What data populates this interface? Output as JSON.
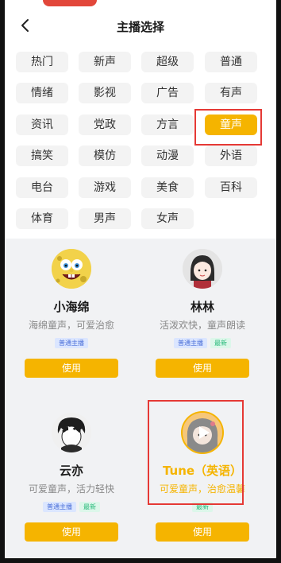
{
  "header": {
    "title": "主播选择",
    "back_icon": "chevron-left-icon"
  },
  "categories": [
    {
      "label": "热门"
    },
    {
      "label": "新声"
    },
    {
      "label": "超级"
    },
    {
      "label": "普通"
    },
    {
      "label": "情绪"
    },
    {
      "label": "影视"
    },
    {
      "label": "广告"
    },
    {
      "label": "有声"
    },
    {
      "label": "资讯"
    },
    {
      "label": "党政"
    },
    {
      "label": "方言"
    },
    {
      "label": "童声",
      "active": true
    },
    {
      "label": "搞笑"
    },
    {
      "label": "模仿"
    },
    {
      "label": "动漫"
    },
    {
      "label": "外语"
    },
    {
      "label": "电台"
    },
    {
      "label": "游戏"
    },
    {
      "label": "美食"
    },
    {
      "label": "百科"
    },
    {
      "label": "体育"
    },
    {
      "label": "男声"
    },
    {
      "label": "女声"
    }
  ],
  "anchors": [
    {
      "name": "小海绵",
      "desc": "海绵童声，可爱治愈",
      "tags": [
        "普通主播"
      ],
      "button": "使用",
      "avatar_icon": "sponge-avatar-icon"
    },
    {
      "name": "林林",
      "desc": "活泼欢快，童声朗读",
      "tags": [
        "普通主播",
        "最新"
      ],
      "button": "使用",
      "avatar_icon": "girl-avatar-icon"
    },
    {
      "name": "云亦",
      "desc": "可爱童声，活力轻快",
      "tags": [
        "普通主播",
        "最新"
      ],
      "button": "使用",
      "avatar_icon": "boy-avatar-icon"
    },
    {
      "name": "Tune（英语）",
      "desc": "可爱童声，治愈温馨",
      "tags": [
        "最新"
      ],
      "button": "使用",
      "avatar_icon": "cartoon-avatar-icon",
      "selected": true
    }
  ],
  "colors": {
    "accent": "#f5b400",
    "highlight": "#e53935",
    "tag_blue": "#4a6fd8",
    "tag_green": "#27b97a"
  }
}
